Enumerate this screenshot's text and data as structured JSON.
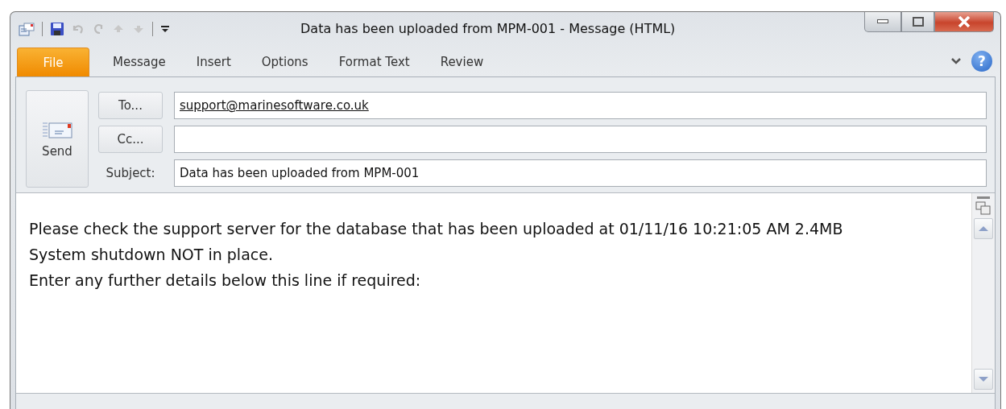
{
  "window": {
    "title": "Data has been uploaded from MPM-001  -  Message (HTML)"
  },
  "tabs": [
    {
      "label": "File",
      "kind": "file",
      "selected": false
    },
    {
      "label": "Message",
      "kind": "tab",
      "selected": false
    },
    {
      "label": "Insert",
      "kind": "tab",
      "selected": false
    },
    {
      "label": "Options",
      "kind": "tab",
      "selected": false
    },
    {
      "label": "Format Text",
      "kind": "tab",
      "selected": false
    },
    {
      "label": "Review",
      "kind": "tab",
      "selected": false
    }
  ],
  "help_button": {
    "label": "?"
  },
  "send_button": {
    "label": "Send"
  },
  "to": {
    "button": "To...",
    "value": "support@marinesoftware.co.uk"
  },
  "cc": {
    "button": "Cc..."
  },
  "subject": {
    "label": "Subject:",
    "value": "Data has been uploaded from MPM-001"
  },
  "body": {
    "lines": [
      "Please check the support server for the database that has been uploaded at 01/11/16 10:21:05 AM 2.4MB",
      "System shutdown NOT in place.",
      "Enter any further details below this line if required:"
    ]
  }
}
